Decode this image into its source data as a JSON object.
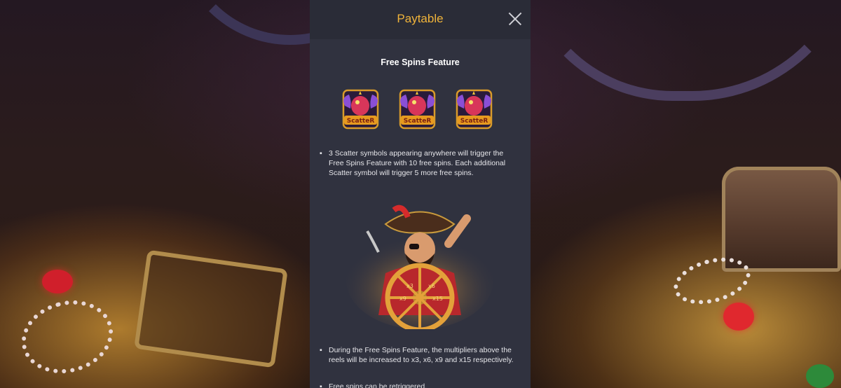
{
  "panel": {
    "title": "Paytable",
    "close_label": "close",
    "section_title": "Free Spins Feature",
    "scatter_symbols": [
      {
        "label": "ScatteR"
      },
      {
        "label": "ScatteR"
      },
      {
        "label": "ScatteR"
      }
    ],
    "descriptions": [
      "3 Scatter symbols appearing anywhere will trigger the Free Spins Feature with 10 free spins. Each additional Scatter symbol will trigger 5 more free spins.",
      "During the Free Spins Feature, the multipliers above the reels will be increased to x3, x6, x9 and x15 respectively.",
      "Free spins can be retriggered."
    ],
    "wheel_multipliers": [
      "x3",
      "x6",
      "x9",
      "x15"
    ]
  },
  "colors": {
    "title": "#f0b43a",
    "panel_bg": "#30323f",
    "header_bg": "#2a2c37"
  }
}
